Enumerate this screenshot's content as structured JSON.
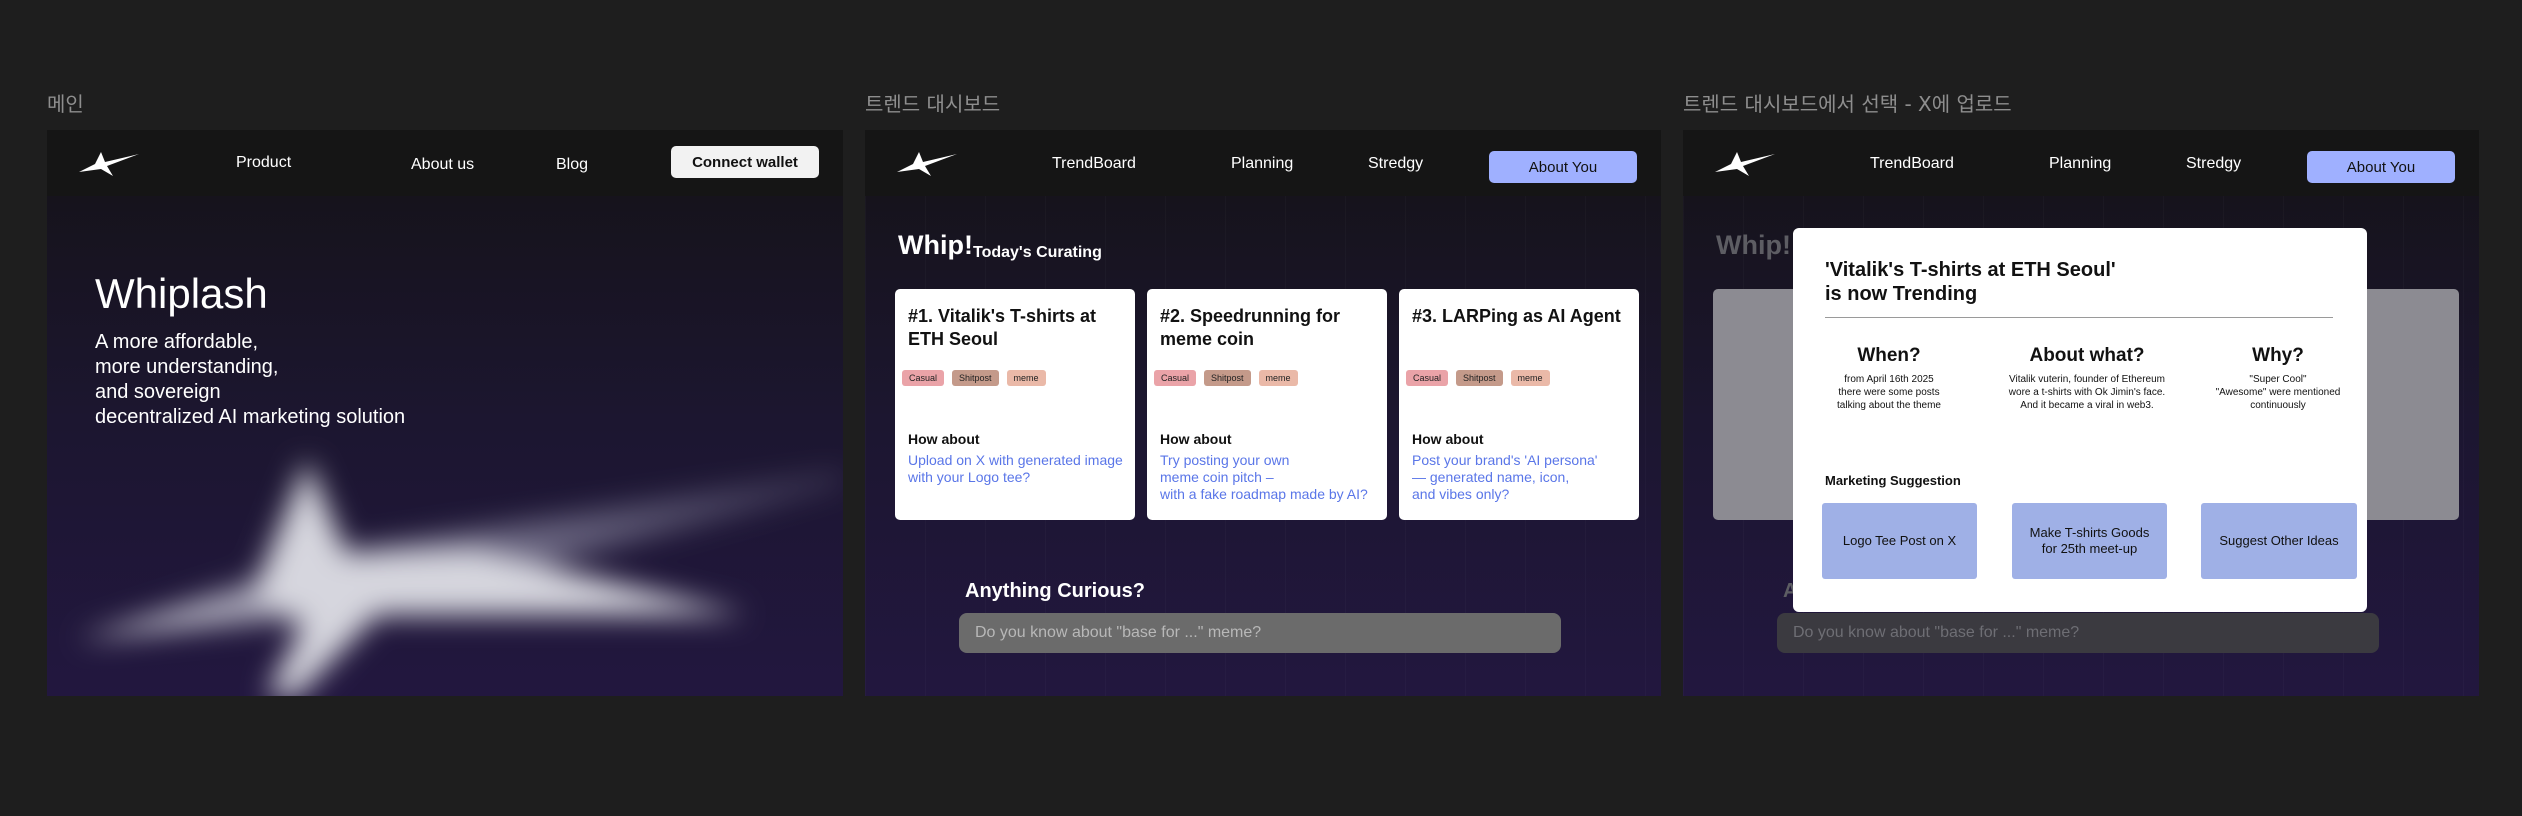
{
  "frames": {
    "main": {
      "label": "메인",
      "nav": {
        "product": "Product",
        "about": "About us",
        "blog": "Blog",
        "connect": "Connect wallet"
      },
      "hero": {
        "title": "Whiplash",
        "subtitle": "A more affordable,\nmore understanding,\nand sovereign\ndecentralized AI marketing solution"
      }
    },
    "dashboard": {
      "label": "트렌드 대시보드",
      "nav": {
        "trendboard": "TrendBoard",
        "planning": "Planning",
        "stredgy": "Stredgy",
        "about_you": "About You"
      },
      "whip": "Whip!",
      "curating": "Today's Curating",
      "tags": [
        "Casual",
        "Shitpost",
        "meme"
      ],
      "how_about": "How about",
      "cards": [
        {
          "title": "#1. Vitalik's T-shirts at ETH Seoul",
          "suggestion": "Upload on X with generated image\nwith your Logo tee?"
        },
        {
          "title": "#2. Speedrunning for meme coin",
          "suggestion": "Try posting your own\nmeme coin pitch –\n with a fake roadmap made by AI?"
        },
        {
          "title": "#3. LARPing as AI Agent",
          "suggestion": "Post your brand's 'AI persona'\n— generated name, icon,\nand vibes only?"
        }
      ],
      "curious": "Anything Curious?",
      "search_placeholder": "Do you know about \"base for ...\" meme?"
    },
    "select": {
      "label": "트렌드 대시보드에서 선택 - X에 업로드",
      "whip": "Whip!",
      "curious_partial": "A",
      "search_placeholder": "Do you know about \"base for ...\" meme?",
      "modal": {
        "title": "'Vitalik's T-shirts at ETH Seoul'\nis now Trending",
        "when_h": "When?",
        "when_t": "from April 16th 2025\nthere were some posts\ntalking about the theme",
        "what_h": "About what?",
        "what_t": "Vitalik vuterin, founder of Ethereum\nwore a t-shirts with Ok Jimin's face.\nAnd it became a viral in web3.",
        "why_h": "Why?",
        "why_t": "\"Super Cool\"\n\"Awesome\" were mentioned\ncontinuously",
        "suggestion_label": "Marketing Suggestion",
        "btn1": "Logo Tee Post on X",
        "btn2": "Make T-shirts Goods\nfor 25th meet-up",
        "btn3": "Suggest Other Ideas"
      }
    }
  },
  "colors": {
    "accent": "#9fb0ff",
    "link": "#5a76e8",
    "tag_casual": "#eaa3a8",
    "tag_shitpost": "#c49a8a",
    "tag_meme": "#eab9a8"
  }
}
